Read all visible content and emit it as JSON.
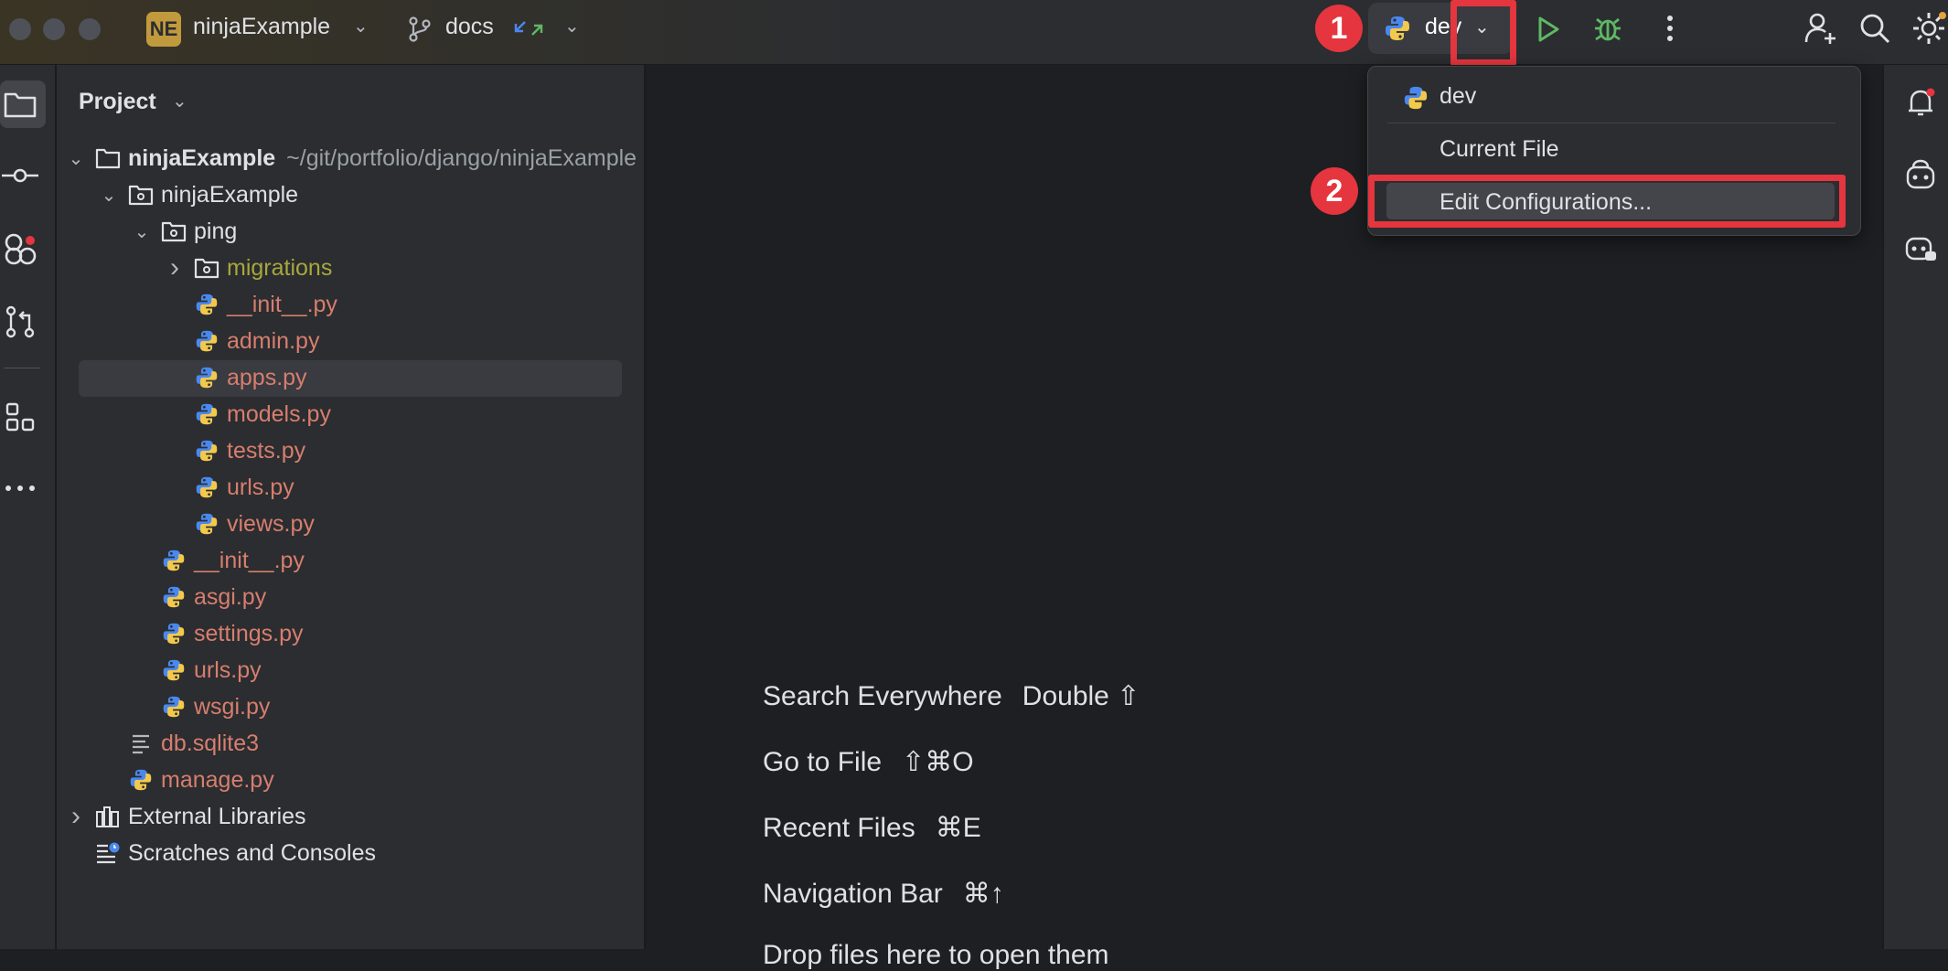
{
  "titlebar": {
    "project_initials": "NE",
    "project_name": "ninjaExample",
    "branch_name": "docs",
    "run_config": "dev"
  },
  "annotations": {
    "step1": "1",
    "step2": "2"
  },
  "panel": {
    "title": "Project"
  },
  "tree": [
    {
      "label": "ninjaExample",
      "path": "~/git/portfolio/django/ninjaExample",
      "kind": "root"
    },
    {
      "label": "ninjaExample",
      "kind": "package"
    },
    {
      "label": "ping",
      "kind": "package"
    },
    {
      "label": "migrations",
      "kind": "migrations"
    },
    {
      "label": "__init__.py",
      "kind": "py"
    },
    {
      "label": "admin.py",
      "kind": "py"
    },
    {
      "label": "apps.py",
      "kind": "py"
    },
    {
      "label": "models.py",
      "kind": "py"
    },
    {
      "label": "tests.py",
      "kind": "py"
    },
    {
      "label": "urls.py",
      "kind": "py"
    },
    {
      "label": "views.py",
      "kind": "py"
    },
    {
      "label": "__init__.py",
      "kind": "py"
    },
    {
      "label": "asgi.py",
      "kind": "py"
    },
    {
      "label": "settings.py",
      "kind": "py"
    },
    {
      "label": "urls.py",
      "kind": "py"
    },
    {
      "label": "wsgi.py",
      "kind": "py"
    },
    {
      "label": "db.sqlite3",
      "kind": "text"
    },
    {
      "label": "manage.py",
      "kind": "py"
    },
    {
      "label": "External Libraries",
      "kind": "libs"
    },
    {
      "label": "Scratches and Consoles",
      "kind": "scratches"
    }
  ],
  "run_dropdown": {
    "items": [
      "dev",
      "Current File",
      "Edit Configurations..."
    ]
  },
  "editor_hints": [
    {
      "action": "Search Everywhere",
      "shortcut": "Double ⇧"
    },
    {
      "action": "Go to File",
      "shortcut": "⇧⌘O"
    },
    {
      "action": "Recent Files",
      "shortcut": "⌘E"
    },
    {
      "action": "Navigation Bar",
      "shortcut": "⌘↑"
    },
    {
      "action": "Drop files here to open them",
      "shortcut": ""
    }
  ],
  "colors": {
    "accent_red": "#e5353e",
    "run_green": "#5fb865",
    "python_file": "#d77e6e"
  }
}
